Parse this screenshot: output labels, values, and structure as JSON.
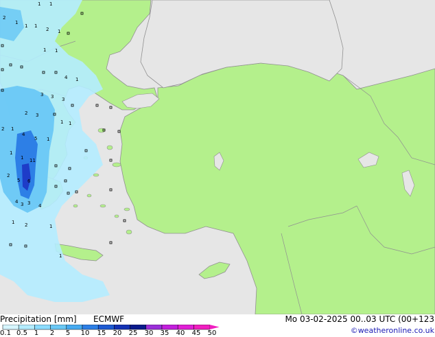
{
  "title_left": "Precipitation [mm]",
  "model": "ECMWF",
  "valid_time": "Mo 03-02-2025 00..03 UTC (00+123",
  "credit": "©weatheronline.co.uk",
  "legend": {
    "ticks": [
      "0.1",
      "0.5",
      "1",
      "2",
      "5",
      "10",
      "15",
      "20",
      "25",
      "30",
      "35",
      "40",
      "45",
      "50"
    ],
    "colors": [
      "#d6f5ff",
      "#b4ecff",
      "#8cdcff",
      "#6ac8f5",
      "#46aaf0",
      "#2d7fe6",
      "#1e5ad2",
      "#1432b4",
      "#0a1a8c",
      "#9b2fd9",
      "#c21fdc",
      "#e11fd6",
      "#f01fc0"
    ]
  },
  "map": {
    "colors": {
      "sea": "#e6e6e6",
      "land": "#b4f08c",
      "border": "#909090",
      "precip_light": "#b4ecff",
      "precip_mid": "#6ac8f5",
      "precip_heavy": "#2d7fe6",
      "precip_max": "#1e3cc8"
    },
    "station_values": [
      "2",
      "1",
      "1",
      "1",
      "2",
      "1",
      "1",
      "3",
      "2",
      "1",
      "1",
      "4",
      "1",
      "1",
      "3",
      "3",
      "2",
      "3",
      "1",
      "1",
      "4",
      "1",
      "1",
      "5",
      "1",
      "1",
      "11",
      "5",
      "2",
      "6",
      "3",
      "4",
      "4",
      "3",
      "1",
      "1",
      "2",
      "1"
    ]
  }
}
